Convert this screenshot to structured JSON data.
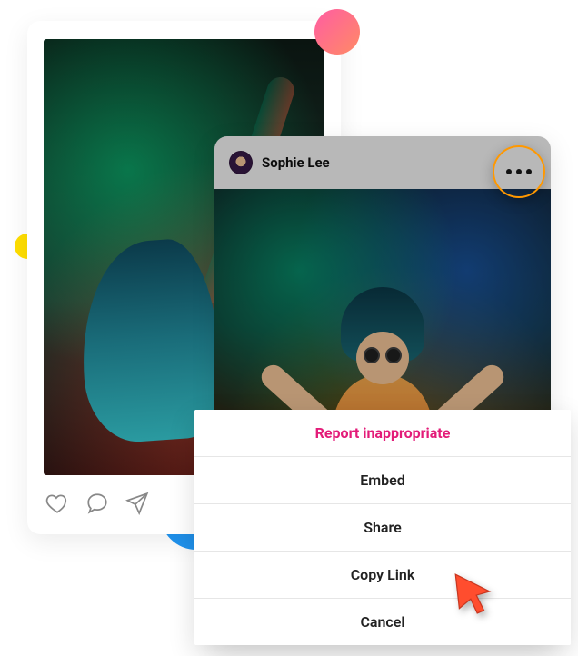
{
  "post_back": {
    "user": "",
    "image_alt": "person with blue hair dancing in green and red smoke"
  },
  "post_front": {
    "user": "Sophie Lee",
    "image_alt": "DJ with blue hair and sunglasses in colorful smoke"
  },
  "sheet": {
    "report": "Report inappropriate",
    "embed": "Embed",
    "share": "Share",
    "copy_link": "Copy Link",
    "cancel": "Cancel"
  },
  "icons": {
    "like": "heart-icon",
    "comment": "speech-bubble-icon",
    "share": "paper-plane-icon",
    "more": "ellipsis-icon"
  },
  "colors": {
    "accent": "#E31C79",
    "more_ring": "#FF9800",
    "blue_circle": "#2196F3",
    "yellow_dot": "#FFDE00"
  }
}
